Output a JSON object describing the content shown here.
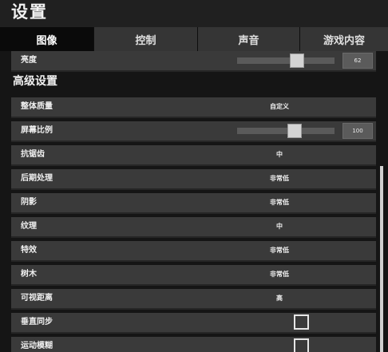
{
  "window": {
    "title": "设置"
  },
  "tabs": [
    {
      "label": "图像",
      "active": true
    },
    {
      "label": "控制",
      "active": false
    },
    {
      "label": "声音",
      "active": false
    },
    {
      "label": "游戏内容",
      "active": false
    }
  ],
  "brightness": {
    "label": "亮度",
    "value": 62,
    "slider_fraction": 0.63
  },
  "advanced": {
    "header": "高级设置",
    "rows": [
      {
        "label": "整体质量",
        "value": "自定义"
      },
      {
        "label": "屏幕比例",
        "value": 100,
        "slider_fraction": 0.61
      },
      {
        "label": "抗锯齿",
        "value": "中"
      },
      {
        "label": "后期处理",
        "value": "非常低"
      },
      {
        "label": "阴影",
        "value": "非常低"
      },
      {
        "label": "纹理",
        "value": "中"
      },
      {
        "label": "特效",
        "value": "非常低"
      },
      {
        "label": "树木",
        "value": "非常低"
      },
      {
        "label": "可视距离",
        "value": "高"
      },
      {
        "label": "垂直同步",
        "checked": false
      },
      {
        "label": "运动模糊",
        "checked": false
      }
    ]
  },
  "colors": {
    "active_tab": "#0a0a0a",
    "tab": "#353535",
    "row": "#3a3a3a",
    "background": "#151515"
  }
}
